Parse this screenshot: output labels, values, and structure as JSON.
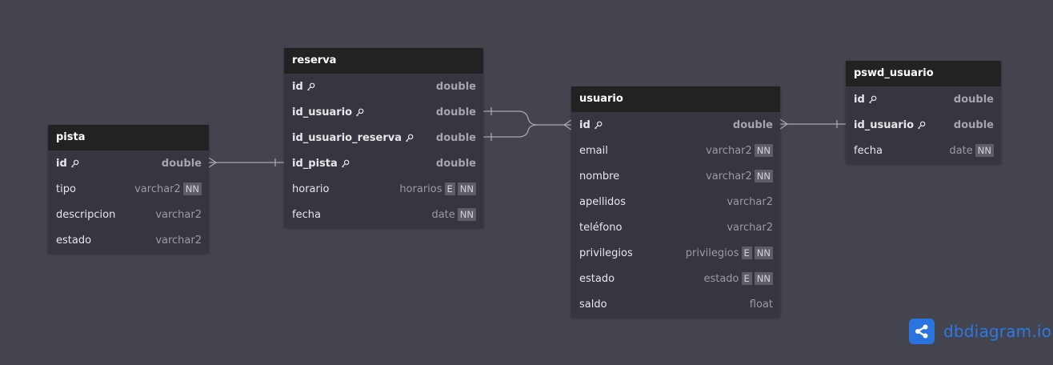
{
  "tables": {
    "pista": {
      "name": "pista",
      "fields": [
        {
          "name": "id",
          "type": "double",
          "pk": true,
          "badges": []
        },
        {
          "name": "tipo",
          "type": "varchar2",
          "badges": [
            "NN"
          ]
        },
        {
          "name": "descripcion",
          "type": "varchar2",
          "badges": []
        },
        {
          "name": "estado",
          "type": "varchar2",
          "badges": []
        }
      ]
    },
    "reserva": {
      "name": "reserva",
      "fields": [
        {
          "name": "id",
          "type": "double",
          "pk": true,
          "badges": []
        },
        {
          "name": "id_usuario",
          "type": "double",
          "pk": true,
          "badges": []
        },
        {
          "name": "id_usuario_reserva",
          "type": "double",
          "pk": true,
          "badges": []
        },
        {
          "name": "id_pista",
          "type": "double",
          "pk": true,
          "badges": []
        },
        {
          "name": "horario",
          "type": "horarios",
          "badges": [
            "E",
            "NN"
          ]
        },
        {
          "name": "fecha",
          "type": "date",
          "badges": [
            "NN"
          ]
        }
      ]
    },
    "usuario": {
      "name": "usuario",
      "fields": [
        {
          "name": "id",
          "type": "double",
          "pk": true,
          "badges": []
        },
        {
          "name": "email",
          "type": "varchar2",
          "badges": [
            "NN"
          ]
        },
        {
          "name": "nombre",
          "type": "varchar2",
          "badges": [
            "NN"
          ]
        },
        {
          "name": "apellidos",
          "type": "varchar2",
          "badges": []
        },
        {
          "name": "teléfono",
          "type": "varchar2",
          "badges": []
        },
        {
          "name": "privilegios",
          "type": "privilegios",
          "badges": [
            "E",
            "NN"
          ]
        },
        {
          "name": "estado",
          "type": "estado",
          "badges": [
            "E",
            "NN"
          ]
        },
        {
          "name": "saldo",
          "type": "float",
          "badges": []
        }
      ]
    },
    "pswd_usuario": {
      "name": "pswd_usuario",
      "fields": [
        {
          "name": "id",
          "type": "double",
          "pk": true,
          "badges": []
        },
        {
          "name": "id_usuario",
          "type": "double",
          "pk": true,
          "badges": []
        },
        {
          "name": "fecha",
          "type": "date",
          "badges": [
            "NN"
          ]
        }
      ]
    }
  },
  "brand": {
    "label": "dbdiagram.io",
    "icon": "share-nodes-icon",
    "color": "#2b74e0"
  },
  "colors": {
    "canvas": "#43444e",
    "header": "#222222",
    "body": "#35363f",
    "link": "#a7a8b0"
  }
}
